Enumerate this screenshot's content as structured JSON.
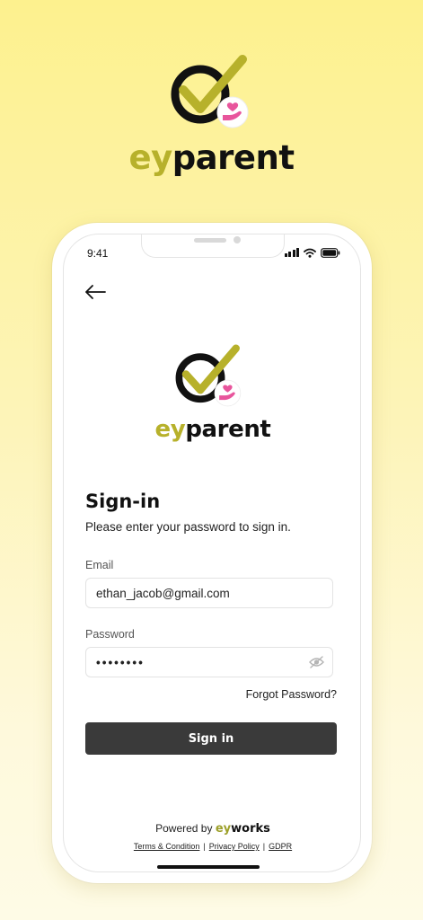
{
  "brand": {
    "wordmark_accent": "ey",
    "wordmark_rest": "parent",
    "accent_color": "#b7b12b",
    "logo_icon": "check-circle-hand-heart-icon"
  },
  "status_bar": {
    "time": "9:41"
  },
  "signin": {
    "title": "Sign-in",
    "subtitle": "Please enter your password to sign in.",
    "email_label": "Email",
    "email_value": "ethan_jacob@gmail.com",
    "password_label": "Password",
    "password_value": "••••••••",
    "forgot_label": "Forgot Password?",
    "button_label": "Sign in"
  },
  "footer": {
    "powered_prefix": "Powered by",
    "powered_brand_ey": "ey",
    "powered_brand_rest": "works",
    "terms": "Terms & Condition",
    "privacy": "Privacy Policy",
    "gdpr": "GDPR",
    "separator": "|"
  }
}
